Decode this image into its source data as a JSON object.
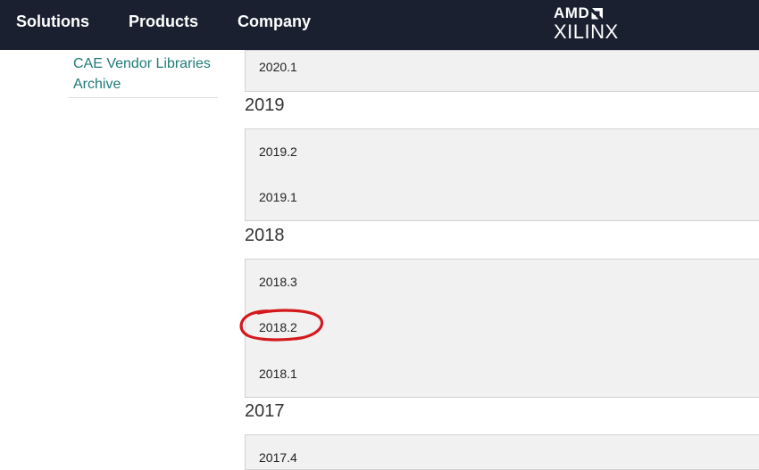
{
  "nav": {
    "items": [
      "Solutions",
      "Products",
      "Company"
    ],
    "logo": {
      "top": "AMD",
      "bottom": "XILINX"
    }
  },
  "sidebar": {
    "link": "CAE Vendor Libraries Archive"
  },
  "versions": {
    "top_partial": [
      "2020.1"
    ],
    "groups": [
      {
        "year": "2019",
        "releases": [
          "2019.2",
          "2019.1"
        ]
      },
      {
        "year": "2018",
        "releases": [
          "2018.3",
          "2018.2",
          "2018.1"
        ]
      },
      {
        "year": "2017",
        "releases": [
          "2017.4"
        ]
      }
    ]
  },
  "annotation": {
    "circled_release": "2018.2",
    "color": "#d4191c"
  },
  "colors": {
    "nav_bg": "#1b2030",
    "link": "#1f7a77",
    "panel_bg": "#f1f1f1",
    "panel_border": "#d2d2d2"
  }
}
